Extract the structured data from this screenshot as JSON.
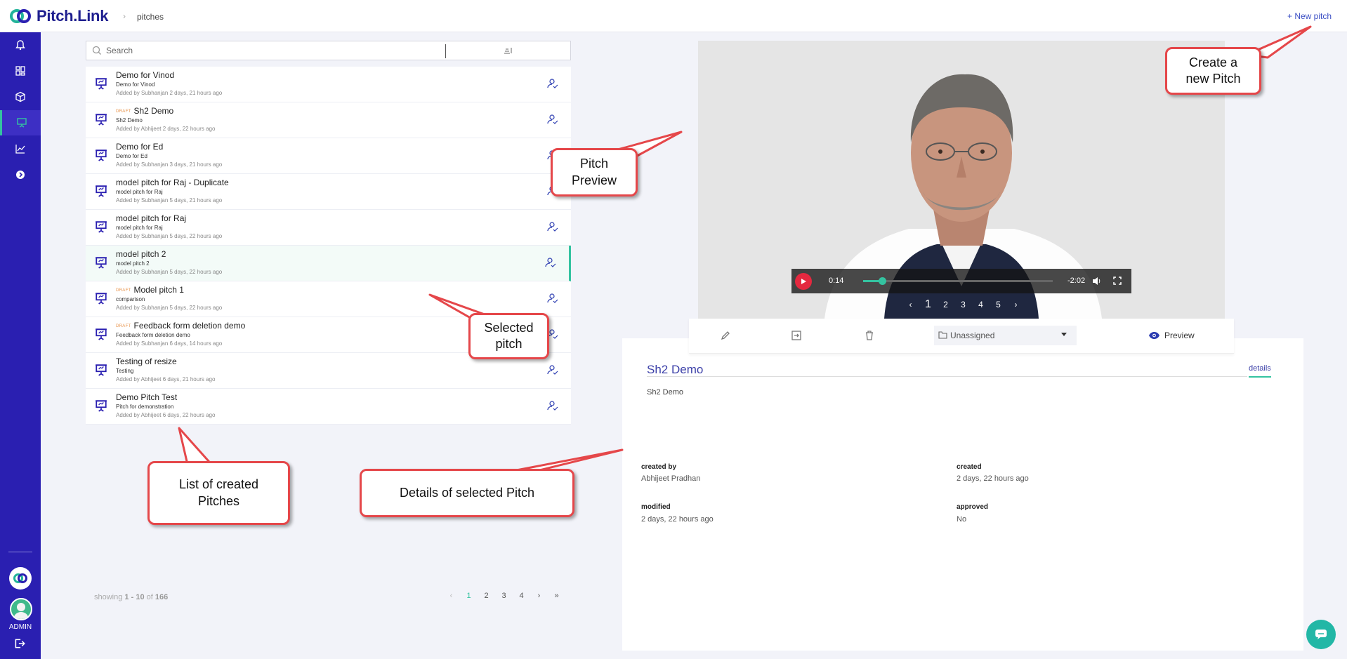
{
  "app": {
    "name": "Pitch.Link",
    "breadcrumb": "pitches",
    "new_pitch_label": "New pitch"
  },
  "sidebar": {
    "admin_label": "ADMIN"
  },
  "search": {
    "placeholder": "Search"
  },
  "pitches": [
    {
      "title": "Demo for Vinod",
      "draft": false,
      "subtitle": "Demo for Vinod",
      "meta": "Added by Subhanjan 2 days, 21 hours ago"
    },
    {
      "title": "Sh2 Demo",
      "draft": true,
      "subtitle": "Sh2 Demo",
      "meta": "Added by Abhijeet 2 days, 22 hours ago"
    },
    {
      "title": "Demo for Ed",
      "draft": false,
      "subtitle": "Demo for Ed",
      "meta": "Added by Subhanjan 3 days, 21 hours ago"
    },
    {
      "title": "model pitch for Raj - Duplicate",
      "draft": false,
      "subtitle": "model pitch for Raj",
      "meta": "Added by Subhanjan 5 days, 21 hours ago"
    },
    {
      "title": "model pitch for Raj",
      "draft": false,
      "subtitle": "model pitch for Raj",
      "meta": "Added by Subhanjan 5 days, 22 hours ago"
    },
    {
      "title": "model pitch 2",
      "draft": false,
      "subtitle": "model pitch 2",
      "meta": "Added by Subhanjan 5 days, 22 hours ago",
      "selected": true
    },
    {
      "title": "Model pitch 1",
      "draft": true,
      "subtitle": "comparison",
      "meta": "Added by Subhanjan 5 days, 22 hours ago"
    },
    {
      "title": "Feedback form deletion demo",
      "draft": true,
      "subtitle": "Feedback form deletion demo",
      "meta": "Added by Subhanjan 6 days, 14 hours ago"
    },
    {
      "title": "Testing of resize",
      "draft": false,
      "subtitle": "Testing",
      "meta": "Added by Abhijeet 6 days, 21 hours ago"
    },
    {
      "title": "Demo Pitch Test",
      "draft": false,
      "subtitle": "Pitch for demonstration",
      "meta": "Added by Abhijeet 6 days, 22 hours ago"
    }
  ],
  "draft_label": "DRAFT",
  "pagination": {
    "showing_prefix": "showing",
    "from": "1",
    "dash": "-",
    "to": "10",
    "of": "of",
    "total": "166",
    "pages": [
      "1",
      "2",
      "3",
      "4"
    ],
    "current": "1",
    "prev": "‹",
    "next": "›",
    "last": "»"
  },
  "video": {
    "current_time": "0:14",
    "remaining": "-2:02",
    "progress": 0.1,
    "slides": [
      "1",
      "2",
      "3",
      "4",
      "5"
    ],
    "current_slide": "1"
  },
  "actions": {
    "folder": "Unassigned",
    "preview_label": "Preview"
  },
  "details": {
    "title": "Sh2 Demo",
    "tab": "details",
    "description": "Sh2 Demo",
    "created_by_label": "created by",
    "created_by": "Abhijeet Pradhan",
    "created_label": "created",
    "created": "2 days, 22 hours ago",
    "modified_label": "modified",
    "modified": "2 days, 22 hours ago",
    "approved_label": "approved",
    "approved": "No"
  },
  "callouts": {
    "create": "Create a\nnew Pitch",
    "preview": "Pitch\nPreview",
    "selected": "Selected\npitch",
    "list": "List of created\nPitches",
    "details": "Details of selected Pitch"
  },
  "colors": {
    "sidebar": "#2a1fb1",
    "accent": "#34c3a0",
    "callout_border": "#e5474a",
    "draft": "#e8944c"
  }
}
